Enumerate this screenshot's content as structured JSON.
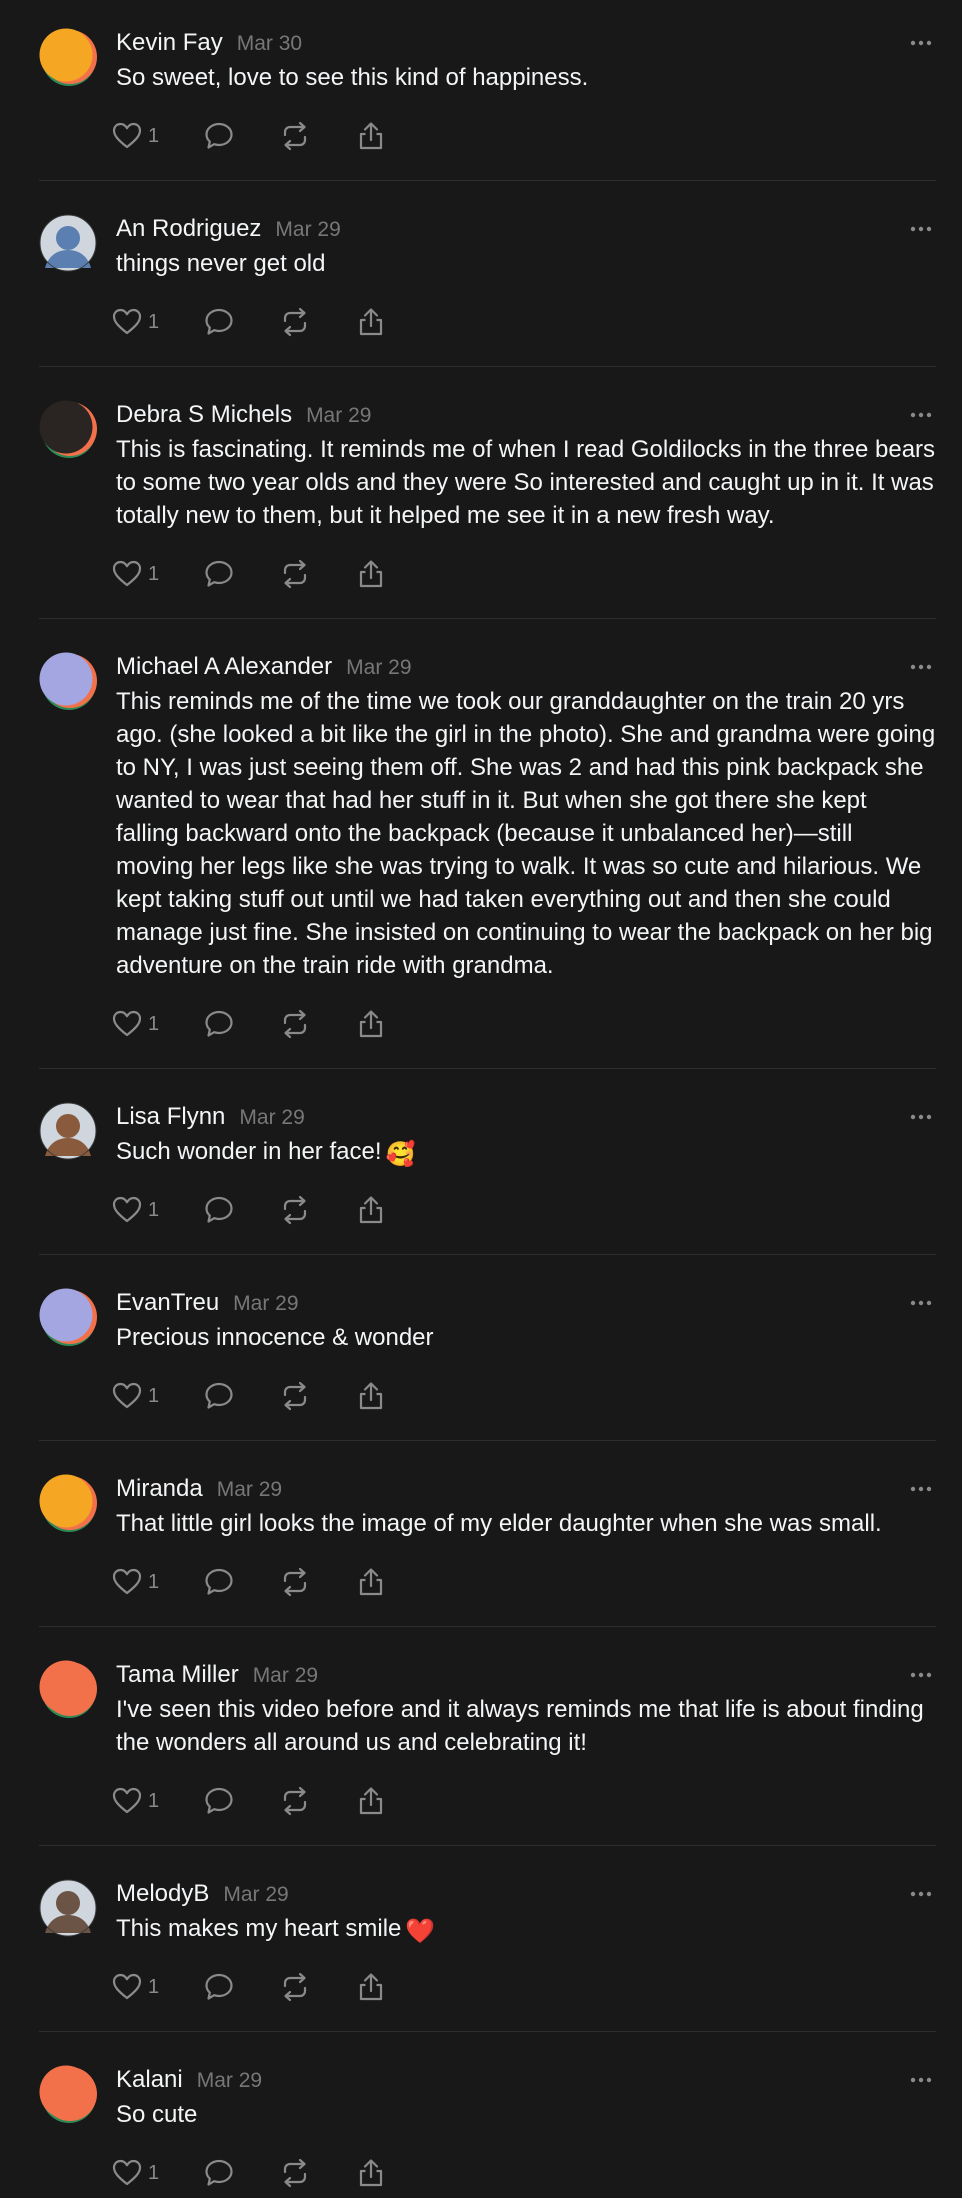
{
  "comments": [
    {
      "author": "Kevin Fay",
      "date": "Mar 30",
      "text": "So sweet, love to see this kind of happiness.",
      "likes": "1",
      "avatar": "default-avatar",
      "avatar_color": "#f5a623"
    },
    {
      "author": "An Rodriguez",
      "date": "Mar 29",
      "text": "things never get old",
      "likes": "1",
      "avatar": "photo-avatar",
      "avatar_color": "#5a7fb0"
    },
    {
      "author": "Debra S Michels",
      "date": "Mar 29",
      "text": "This is fascinating. It reminds me of when I read Goldilocks in the three bears to some two year olds and they were So interested and caught up in it. It was totally new to them, but it helped me see it in a new fresh way.",
      "likes": "1",
      "avatar": "default-avatar",
      "avatar_color": "#2a2522"
    },
    {
      "author": "Michael A Alexander",
      "date": "Mar 29",
      "text": "This reminds me of the time we took our granddaughter on the train 20 yrs ago. (she looked a bit like the girl in the photo). She and grandma were going to NY, I was just seeing them off. She was 2 and had this pink backpack she wanted to wear that had her stuff in it. But when she got there she kept falling backward onto the backpack (because it unbalanced her)—still moving her legs like she was trying to walk. It was so cute and hilarious. We kept taking stuff out until we had taken everything out and then she could manage just fine. She insisted on continuing to wear the backpack on her big adventure on the train ride with grandma.",
      "likes": "1",
      "avatar": "default-avatar",
      "avatar_color": "#a3a6e0"
    },
    {
      "author": "Lisa Flynn",
      "date": "Mar 29",
      "text": "Such wonder in her face!",
      "emoji": "🥰",
      "likes": "1",
      "avatar": "photo-avatar",
      "avatar_color": "#8a5a3c"
    },
    {
      "author": "EvanTreu",
      "date": "Mar 29",
      "text": "Precious innocence & wonder",
      "likes": "1",
      "avatar": "default-avatar",
      "avatar_color": "#a3a6e0"
    },
    {
      "author": "Miranda",
      "date": "Mar 29",
      "text": "That little girl looks the image of my elder daughter when she was small.",
      "likes": "1",
      "avatar": "default-avatar",
      "avatar_color": "#f5a623"
    },
    {
      "author": "Tama Miller",
      "date": "Mar 29",
      "text": "I've seen this video before and it always reminds me that life is about finding the wonders all around us and celebrating it!",
      "likes": "1",
      "avatar": "default-avatar",
      "avatar_color": "#f2714a"
    },
    {
      "author": "MelodyB",
      "date": "Mar 29",
      "text": "This makes my heart smile",
      "emoji": "❤️",
      "likes": "1",
      "avatar": "photo-avatar",
      "avatar_color": "#6b5446"
    },
    {
      "author": "Kalani",
      "date": "Mar 29",
      "text": "So cute",
      "likes": "1",
      "avatar": "default-avatar",
      "avatar_color": "#f2714a"
    }
  ]
}
